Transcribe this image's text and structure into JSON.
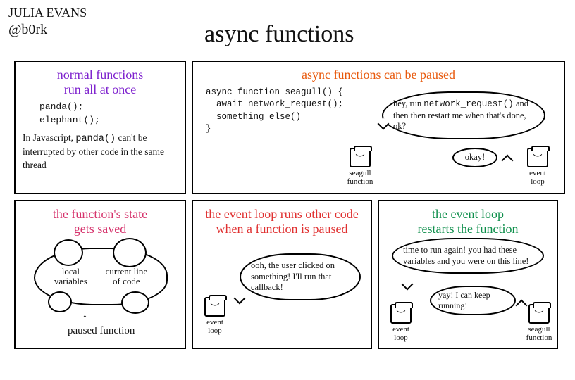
{
  "author": {
    "name": "JULIA EVANS",
    "handle": "@b0rk"
  },
  "title": "async functions",
  "panel1": {
    "title": "normal functions\nrun all at once",
    "code": "panda();\nelephant();",
    "text_parts": [
      "In Javascript, ",
      "panda()",
      " can't be interrupted by other code in the same thread"
    ]
  },
  "panel2": {
    "title": "async functions can be paused",
    "code": "async function seagull() {\n  await network_request();\n  something_else()\n}",
    "speech1_parts": [
      "hey, run ",
      "network_request()",
      " and then then restart me when that's done, ok?"
    ],
    "speech2": "okay!",
    "char1": "seagull\nfunction",
    "char2": "event\nloop"
  },
  "panel3": {
    "title": "the function's state\ngets saved",
    "cloud_left": "local\nvariables",
    "cloud_right": "current line\nof code",
    "label": "paused function"
  },
  "panel4": {
    "title": "the event loop runs other code when a function is paused",
    "speech": "ooh, the user clicked on something! I'll run that callback!",
    "char": "event\nloop"
  },
  "panel5": {
    "title": "the event loop\nrestarts the function",
    "speech1": "time to run again! you had these variables and you were on this line!",
    "speech2": "yay! I can keep running!",
    "char1": "event\nloop",
    "char2": "seagull\nfunction"
  }
}
